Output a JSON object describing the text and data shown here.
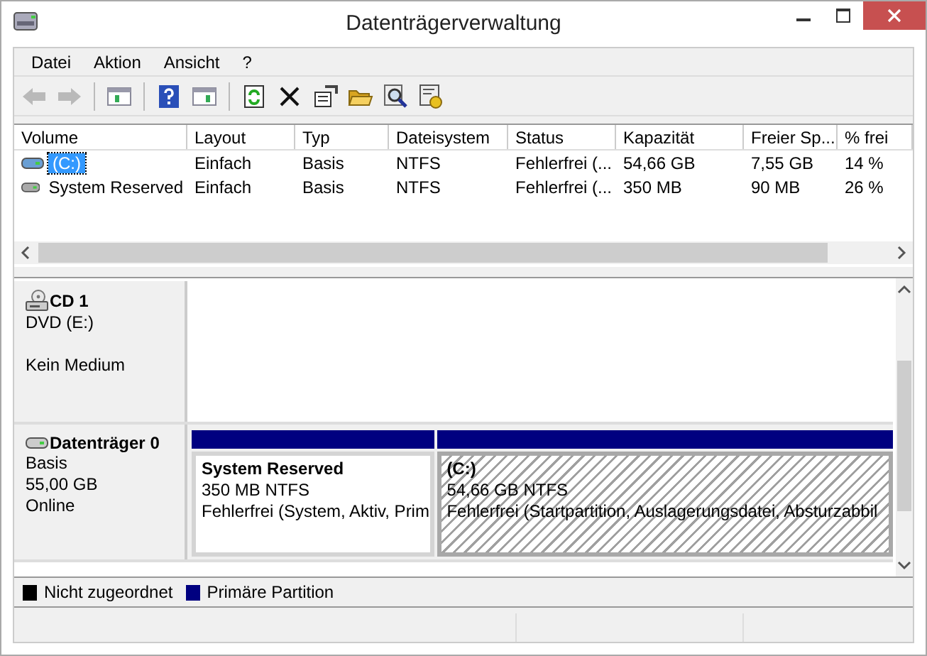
{
  "window": {
    "title": "Datenträgerverwaltung"
  },
  "menu": [
    "Datei",
    "Aktion",
    "Ansicht",
    "?"
  ],
  "toolbar": [
    {
      "kind": "back",
      "disabled": true
    },
    {
      "kind": "forward",
      "disabled": true
    },
    {
      "kind": "sep"
    },
    {
      "kind": "tree",
      "disabled": false
    },
    {
      "kind": "sep"
    },
    {
      "kind": "help",
      "disabled": false
    },
    {
      "kind": "pane",
      "disabled": false
    },
    {
      "kind": "sep"
    },
    {
      "kind": "refresh",
      "disabled": false
    },
    {
      "kind": "delete",
      "disabled": false
    },
    {
      "kind": "properties",
      "disabled": false
    },
    {
      "kind": "open",
      "disabled": false
    },
    {
      "kind": "search",
      "disabled": false
    },
    {
      "kind": "settings",
      "disabled": false
    }
  ],
  "table": {
    "columns": [
      "Volume",
      "Layout",
      "Typ",
      "Dateisystem",
      "Status",
      "Kapazität",
      "Freier Sp...",
      "% frei"
    ],
    "rows": [
      {
        "selected": true,
        "cells": [
          "(C:)",
          "Einfach",
          "Basis",
          "NTFS",
          "Fehlerfrei (...",
          "54,66 GB",
          "7,55 GB",
          "14 %"
        ]
      },
      {
        "selected": false,
        "cells": [
          "System Reserved",
          "Einfach",
          "Basis",
          "NTFS",
          "Fehlerfrei (...",
          "350 MB",
          "90 MB",
          "26 %"
        ]
      }
    ]
  },
  "disks": [
    {
      "kind": "cd",
      "name": "CD 1",
      "lines": [
        "DVD (E:)",
        "Kein Medium"
      ]
    },
    {
      "kind": "disk",
      "name": "Datenträger 0",
      "lines": [
        "Basis",
        "55,00 GB",
        "Online"
      ],
      "partitions": [
        {
          "name": "System Reserved",
          "size": "350 MB NTFS",
          "status": "Fehlerfrei (System, Aktiv, Prim",
          "color": "#000080",
          "selected": false
        },
        {
          "name": "(C:)",
          "size": "54,66 GB NTFS",
          "status": "Fehlerfrei (Startpartition, Auslagerungsdatei, Absturzabbil",
          "color": "#000080",
          "selected": true
        }
      ]
    }
  ],
  "legend": [
    {
      "label": "Nicht zugeordnet",
      "color": "#000000"
    },
    {
      "label": "Primäre Partition",
      "color": "#000080"
    }
  ]
}
